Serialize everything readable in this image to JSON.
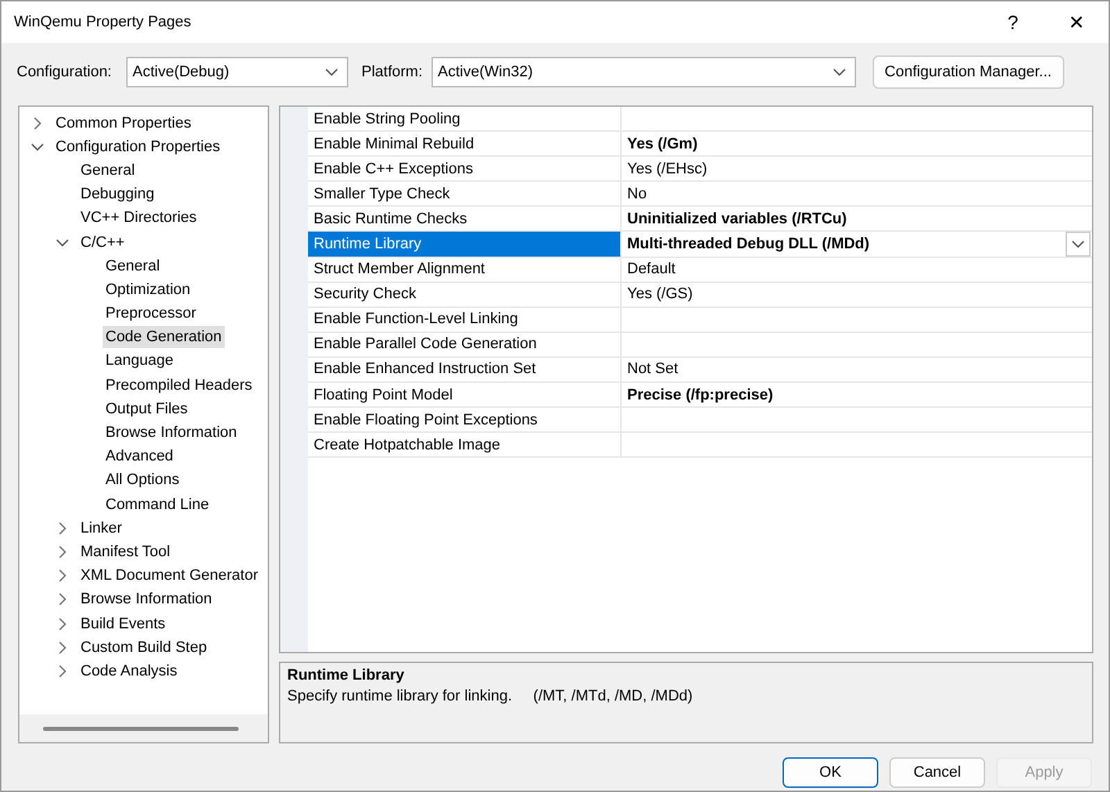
{
  "window": {
    "title": "WinQemu Property Pages",
    "help": "?",
    "close": "✕"
  },
  "configuration": {
    "label": "Configuration:",
    "value": "Active(Debug)"
  },
  "platform": {
    "label": "Platform:",
    "value": "Active(Win32)"
  },
  "config_manager_button": "Configuration Manager...",
  "tree": [
    {
      "label": "Common Properties",
      "expanded": false,
      "selected": false
    },
    {
      "label": "Configuration Properties",
      "expanded": true,
      "selected": false,
      "children": [
        {
          "label": "General",
          "selected": false
        },
        {
          "label": "Debugging",
          "selected": false
        },
        {
          "label": "VC++ Directories",
          "selected": false
        },
        {
          "label": "C/C++",
          "expanded": true,
          "selected": false,
          "children": [
            {
              "label": "General",
              "selected": false
            },
            {
              "label": "Optimization",
              "selected": false
            },
            {
              "label": "Preprocessor",
              "selected": false
            },
            {
              "label": "Code Generation",
              "selected": true
            },
            {
              "label": "Language",
              "selected": false
            },
            {
              "label": "Precompiled Headers",
              "selected": false
            },
            {
              "label": "Output Files",
              "selected": false
            },
            {
              "label": "Browse Information",
              "selected": false
            },
            {
              "label": "Advanced",
              "selected": false
            },
            {
              "label": "All Options",
              "selected": false
            },
            {
              "label": "Command Line",
              "selected": false
            }
          ]
        },
        {
          "label": "Linker",
          "expanded": false,
          "selected": false
        },
        {
          "label": "Manifest Tool",
          "expanded": false,
          "selected": false
        },
        {
          "label": "XML Document Generator",
          "expanded": false,
          "selected": false
        },
        {
          "label": "Browse Information",
          "expanded": false,
          "selected": false
        },
        {
          "label": "Build Events",
          "expanded": false,
          "selected": false
        },
        {
          "label": "Custom Build Step",
          "expanded": false,
          "selected": false
        },
        {
          "label": "Code Analysis",
          "expanded": false,
          "selected": false
        }
      ]
    }
  ],
  "properties": [
    {
      "name": "Enable String Pooling",
      "selected": false
    },
    {
      "name": "Enable Minimal Rebuild",
      "value": "Yes (/Gm)",
      "selected": false,
      "modified": true
    },
    {
      "name": "Enable C++ Exceptions",
      "value": "Yes (/EHsc)",
      "selected": false,
      "modified": false
    },
    {
      "name": "Smaller Type Check",
      "value": "No",
      "selected": false,
      "modified": false
    },
    {
      "name": "Basic Runtime Checks",
      "value": "Uninitialized variables (/RTCu)",
      "selected": false,
      "modified": true
    },
    {
      "name": "Runtime Library",
      "value": "Multi-threaded Debug DLL (/MDd)",
      "selected": true,
      "modified": true
    },
    {
      "name": "Struct Member Alignment",
      "value": "Default",
      "selected": false,
      "modified": false
    },
    {
      "name": "Security Check",
      "value": "Yes (/GS)",
      "selected": false,
      "modified": false
    },
    {
      "name": "Enable Function-Level Linking",
      "selected": false
    },
    {
      "name": "Enable Parallel Code Generation",
      "selected": false
    },
    {
      "name": "Enable Enhanced Instruction Set",
      "value": "Not Set",
      "selected": false,
      "modified": false
    },
    {
      "name": "Floating Point Model",
      "value": "Precise (/fp:precise)",
      "selected": false,
      "modified": true
    },
    {
      "name": "Enable Floating Point Exceptions",
      "selected": false
    },
    {
      "name": "Create Hotpatchable Image",
      "selected": false
    }
  ],
  "description": {
    "title": "Runtime Library",
    "text": "Specify runtime library for linking.     (/MT, /MTd, /MD, /MDd)"
  },
  "buttons": [
    {
      "label": "OK",
      "default": true,
      "disabled": false
    },
    {
      "label": "Cancel",
      "default": false,
      "disabled": false
    },
    {
      "label": "Apply",
      "default": false,
      "disabled": true
    }
  ]
}
